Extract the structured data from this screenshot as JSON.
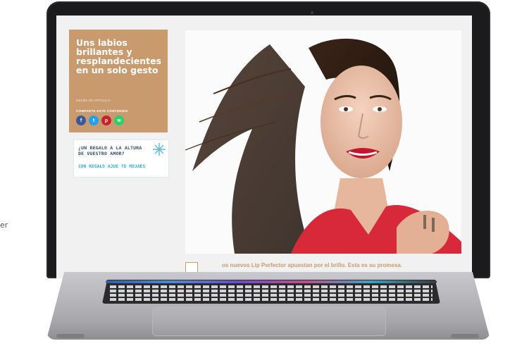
{
  "left_cut_text": "er",
  "article": {
    "title": "Uns labios brillantes y resplandecientes en un solo gesto",
    "date": "DESDE MI ARTÍCULO",
    "share_label": "COMPARTE ESTE CONTENIDO",
    "social_icons": [
      {
        "name": "facebook",
        "glyph": "f",
        "color": "#3b5998"
      },
      {
        "name": "twitter",
        "glyph": "t",
        "color": "#1da1f2"
      },
      {
        "name": "pinterest",
        "glyph": "p",
        "color": "#cb2027"
      },
      {
        "name": "whatsapp",
        "glyph": "w",
        "color": "#25d366"
      }
    ],
    "caption": "os nuevos Lip Perfector apuestan por el brillo. Esta es su promesa."
  },
  "promo": {
    "line1": "¿UN REGALO A LA ALTURA DE VUESTRO AMOR?",
    "line2": "CON REGALO AJUE TE MOJAES"
  },
  "colors": {
    "accent": "#c99a6e",
    "promo_blue": "#2da7d9",
    "promo_dark": "#2e4a63"
  }
}
